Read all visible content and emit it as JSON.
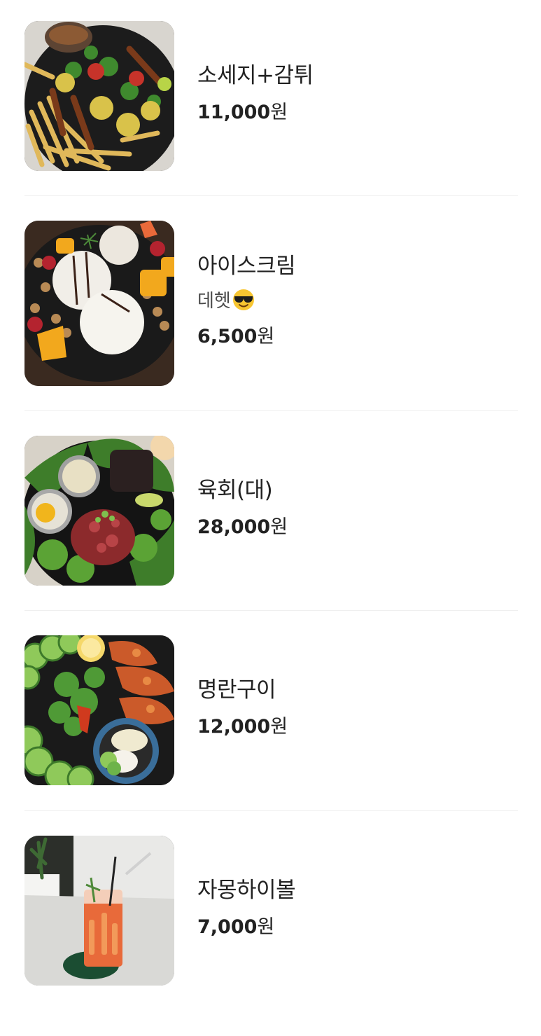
{
  "menu": {
    "items": [
      {
        "name": "소세지+감튀",
        "description": "",
        "price": "11,000",
        "currency": "원",
        "image": "sausage-fries-photo"
      },
      {
        "name": "아이스크림",
        "description": "데헷",
        "description_emoji": "smiling-face-with-sunglasses-icon",
        "price": "6,500",
        "currency": "원",
        "image": "ice-cream-platter-photo"
      },
      {
        "name": "육회(대)",
        "description": "",
        "price": "28,000",
        "currency": "원",
        "image": "beef-tartare-photo"
      },
      {
        "name": "명란구이",
        "description": "",
        "price": "12,000",
        "currency": "원",
        "image": "grilled-pollock-roe-photo"
      },
      {
        "name": "자몽하이볼",
        "description": "",
        "price": "7,000",
        "currency": "원",
        "image": "grapefruit-highball-photo"
      }
    ]
  }
}
